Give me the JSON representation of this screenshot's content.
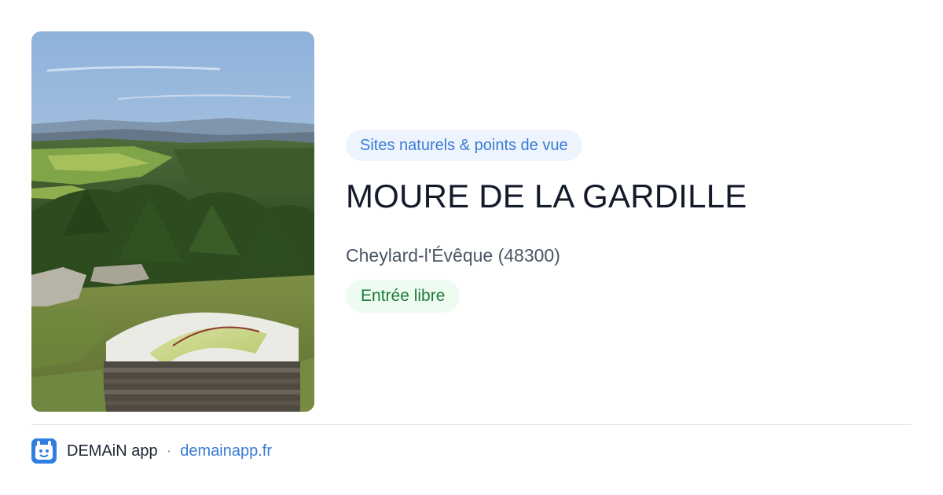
{
  "photo": {
    "description_icon": "landscape-photo"
  },
  "category": {
    "label": "Sites naturels & points de vue"
  },
  "place": {
    "title": "MOURE DE LA GARDILLE",
    "location": "Cheylard-l'Évêque (48300)",
    "access": "Entrée libre"
  },
  "footer": {
    "app_name": "DEMAiN app",
    "separator": "·",
    "url": "demainapp.fr"
  },
  "colors": {
    "accent": "#3a7bd5",
    "badge_blue_bg": "#eef4fd",
    "badge_green_bg": "#eefbf1",
    "badge_green_text": "#1f7a3a",
    "title": "#131a2a",
    "logo": "#2f7ee0"
  }
}
